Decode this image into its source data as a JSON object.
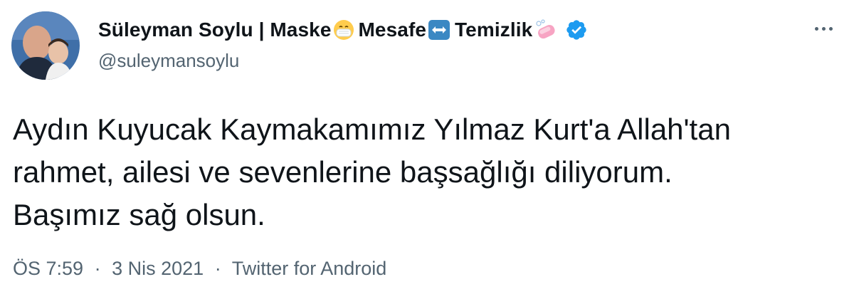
{
  "author": {
    "name_part1": "Süleyman Soylu | Maske",
    "name_part2": "Mesafe",
    "name_part3": "Temizlik",
    "emoji1": "mask-face-emoji",
    "emoji2": "left-right-arrow-emoji",
    "emoji3": "soap-emoji",
    "verified": "verified-badge-icon",
    "handle": "@suleymansoylu"
  },
  "tweet": {
    "lines": [
      "Aydın Kuyucak Kaymakamımız Yılmaz Kurt'a Allah'tan",
      "rahmet, ailesi ve sevenlerine başsağlığı diliyorum.",
      "Başımız sağ olsun."
    ]
  },
  "meta": {
    "time": "ÖS 7:59",
    "separator": "·",
    "date": "3 Nis 2021",
    "source": "Twitter for Android"
  },
  "colors": {
    "text": "#0f1419",
    "secondary": "#536471",
    "verified": "#1d9bf0"
  }
}
